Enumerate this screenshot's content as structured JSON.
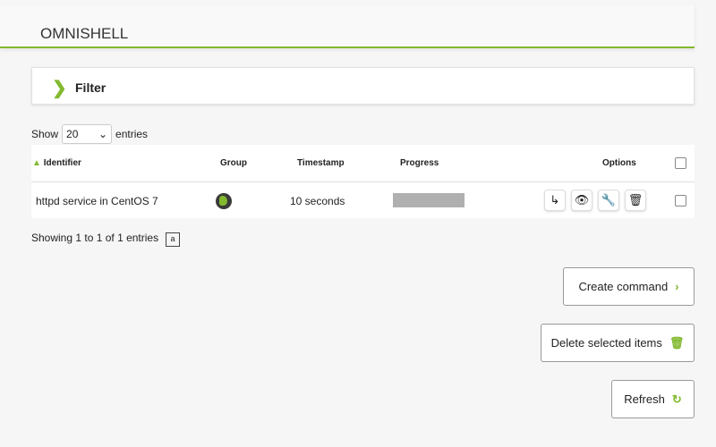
{
  "header": {
    "title": "OMNISHELL"
  },
  "filter": {
    "label": "Filter"
  },
  "length": {
    "show": "Show",
    "value": "20",
    "entries": "entries"
  },
  "table": {
    "columns": [
      "Identifier",
      "Group",
      "Timestamp",
      "Progress",
      "Options"
    ],
    "rows": [
      {
        "identifier": "httpd service in CentOS 7",
        "group_icon": "globe-icon",
        "timestamp": "10 seconds",
        "progress": 0
      }
    ]
  },
  "info": "Showing 1 to 1 of 1 entries",
  "buttons": {
    "create": "Create command",
    "delete": "Delete selected items",
    "refresh": "Refresh"
  },
  "colors": {
    "accent": "#82b92e"
  }
}
